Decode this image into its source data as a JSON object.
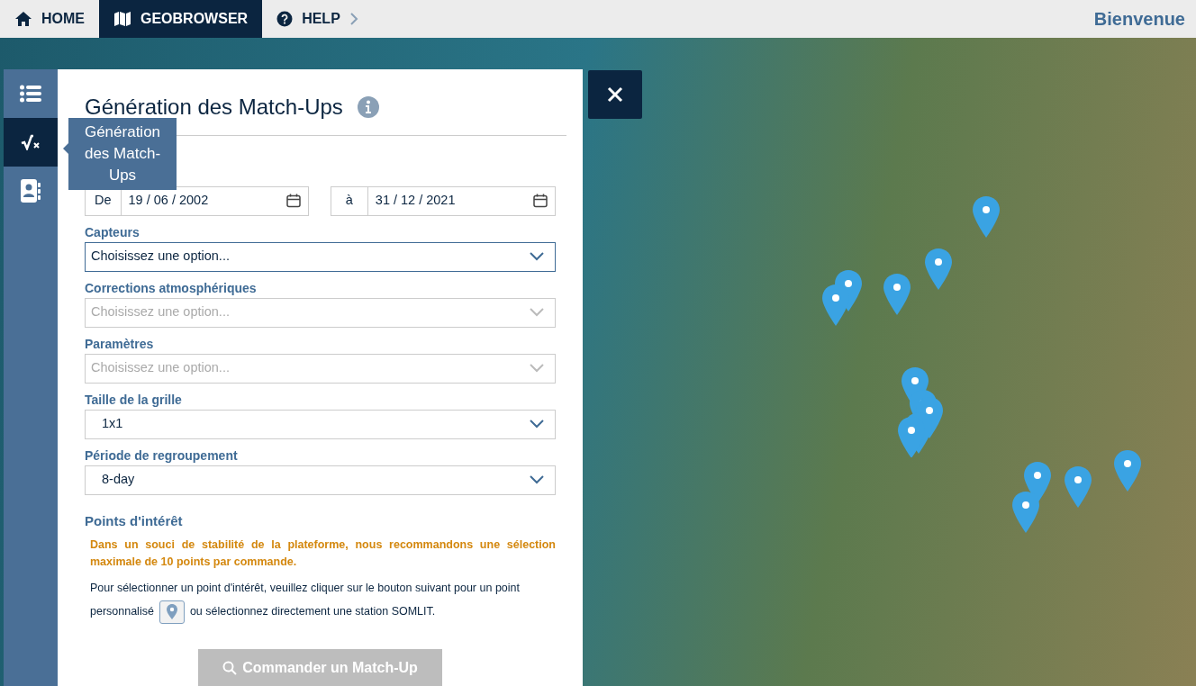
{
  "nav": {
    "items": [
      {
        "label": "HOME",
        "kind": "home",
        "selected": false
      },
      {
        "label": "GEOBROWSER",
        "kind": "map",
        "selected": true
      },
      {
        "label": "HELP",
        "kind": "help",
        "selected": false
      }
    ],
    "welcome": "Bienvenue"
  },
  "sidebar": {
    "items": [
      {
        "kind": "list",
        "selected": false
      },
      {
        "kind": "sqrt",
        "selected": true
      },
      {
        "kind": "contacts",
        "selected": false
      }
    ],
    "tooltip": "Génération des Match-Ups"
  },
  "panel": {
    "title": "Génération des Match-Ups",
    "date_from": {
      "label": "De",
      "value": "19 / 06 / 2002"
    },
    "date_to": {
      "label": "à",
      "value": "31 / 12 / 2021"
    },
    "fields": [
      {
        "label": "Capteurs",
        "placeholder": "Choisissez une option...",
        "disabled": false,
        "focused": true
      },
      {
        "label": "Corrections atmosphériques",
        "placeholder": "Choisissez une option...",
        "disabled": true,
        "focused": false
      },
      {
        "label": "Paramètres",
        "placeholder": "Choisissez une option...",
        "disabled": true,
        "focused": false
      },
      {
        "label": "Taille de la grille",
        "value": "1x1",
        "disabled": false,
        "focused": false
      },
      {
        "label": "Période de regroupement",
        "value": "8-day",
        "disabled": false,
        "focused": false
      }
    ],
    "points": {
      "heading": "Points d'intérêt",
      "warning": "Dans un souci de stabilité de la plateforme, nous recommandons une sélection maximale de 10 points par commande.",
      "text_before": "Pour sélectionner un point d'intérêt, veuillez cliquer sur le bouton suivant pour un point",
      "text_mid": "personnalisé",
      "text_after": "ou sélectionnez directement une station SOMLIT."
    },
    "submit": {
      "label": "Commander un Match-Up",
      "disabled": true
    }
  }
}
